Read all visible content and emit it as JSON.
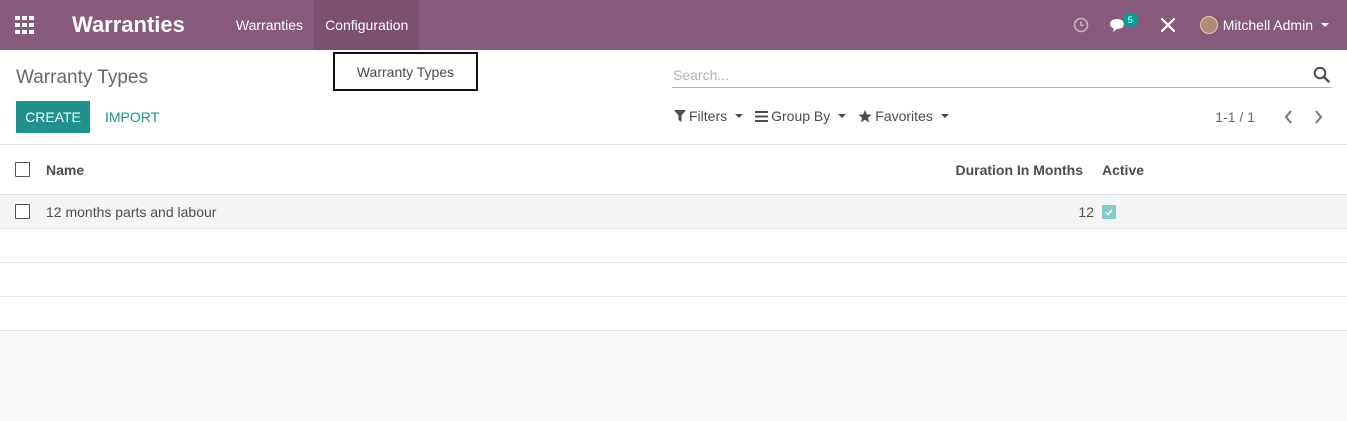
{
  "navbar": {
    "apps_icon": "apps-grid-icon",
    "brand": "Warranties",
    "menu": [
      {
        "label": "Warranties"
      },
      {
        "label": "Configuration"
      }
    ],
    "activity_icon": "clock-icon",
    "messages_icon": "chat-icon",
    "messages_count": "5",
    "debug_icon": "tools-icon",
    "user_name": "Mitchell Admin",
    "accent_color": "#875a7b"
  },
  "dropdown": {
    "items": [
      {
        "label": "Warranty Types"
      }
    ]
  },
  "control_panel": {
    "breadcrumb": "Warranty Types",
    "create_label": "CREATE",
    "import_label": "IMPORT",
    "search_placeholder": "Search...",
    "filters_label": "Filters",
    "groupby_label": "Group By",
    "favorites_label": "Favorites",
    "pager_value": "1-1 / 1",
    "primary_color": "#21918b"
  },
  "table": {
    "columns": {
      "name": "Name",
      "duration": "Duration In Months",
      "active": "Active"
    },
    "rows": [
      {
        "name": "12 months parts and labour",
        "duration": "12",
        "active": true
      }
    ]
  }
}
